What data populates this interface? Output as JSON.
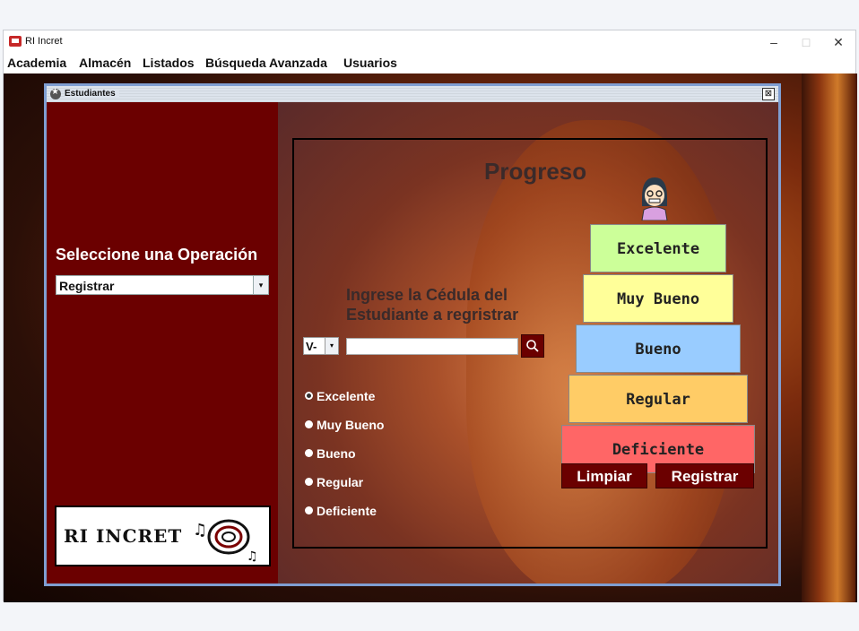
{
  "window": {
    "title": "RI Incret",
    "controls": [
      "–",
      "□",
      "✕"
    ]
  },
  "menu": [
    "Academia",
    "Almacén",
    "Listados",
    "Búsqueda Avanzada",
    "Usuarios"
  ],
  "internal_frame": {
    "title": "Estudiantes",
    "close": "⊠"
  },
  "left": {
    "label": "Seleccione una Operación",
    "operation": {
      "value": "Registrar",
      "arrow": "▾"
    },
    "logo_text": "RI INCRET"
  },
  "form": {
    "title": "Progreso",
    "prompt_line1": "Ingrese la Cédula del",
    "prompt_line2": "Estudiante a regristrar",
    "id_prefix": {
      "value": "V-",
      "arrow": "▾"
    },
    "cedula_value": "",
    "radios": [
      {
        "label": "Excelente",
        "selected": true
      },
      {
        "label": "Muy Bueno",
        "selected": false
      },
      {
        "label": "Bueno",
        "selected": false
      },
      {
        "label": "Regular",
        "selected": false
      },
      {
        "label": "Deficiente",
        "selected": false
      }
    ],
    "levels": [
      {
        "label": "Excelente",
        "color": "#ccff99"
      },
      {
        "label": "Muy Bueno",
        "color": "#ffff99"
      },
      {
        "label": "Bueno",
        "color": "#99ccff"
      },
      {
        "label": "Regular",
        "color": "#ffcc66"
      },
      {
        "label": "Deficiente",
        "color": "#ff6666"
      }
    ],
    "buttons": {
      "clear": "Limpiar",
      "register": "Registrar"
    }
  }
}
